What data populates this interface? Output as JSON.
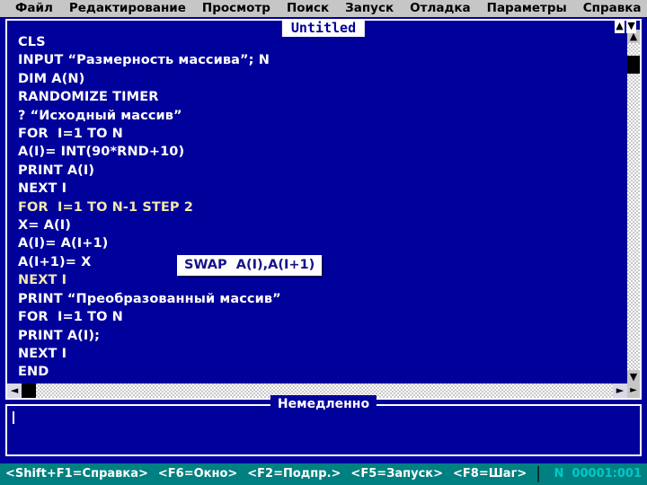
{
  "menubar": {
    "items": [
      {
        "label": "Файл",
        "name": "menu-file"
      },
      {
        "label": "Редактирование",
        "name": "menu-edit"
      },
      {
        "label": "Просмотр",
        "name": "menu-view"
      },
      {
        "label": "Поиск",
        "name": "menu-search"
      },
      {
        "label": "Запуск",
        "name": "menu-run"
      },
      {
        "label": "Отладка",
        "name": "menu-debug"
      },
      {
        "label": "Параметры",
        "name": "menu-options"
      },
      {
        "label": "Справка",
        "name": "menu-help"
      }
    ]
  },
  "editor": {
    "title": "Untitled",
    "scroll_marks": {
      "up": "▲",
      "down": "▼"
    },
    "code_lines": [
      {
        "text": "CLS",
        "highlight": false
      },
      {
        "text": "INPUT “Размерность массива”; N",
        "highlight": false
      },
      {
        "text": "DIM A(N)",
        "highlight": false
      },
      {
        "text": "RANDOMIZE TIMER",
        "highlight": false
      },
      {
        "text": "? “Исходный массив”",
        "highlight": false
      },
      {
        "text": "FOR  I=1 TO N",
        "highlight": false
      },
      {
        "text": "A(I)= INT(90*RND+10)",
        "highlight": false
      },
      {
        "text": "PRINT A(I)",
        "highlight": false
      },
      {
        "text": "NEXT I",
        "highlight": false
      },
      {
        "text": "FOR  I=1 TO N-1 STEP 2",
        "highlight": true
      },
      {
        "text": "X= A(I)",
        "highlight": false
      },
      {
        "text": "A(I)= A(I+1)",
        "highlight": false
      },
      {
        "text": "A(I+1)= X",
        "highlight": false
      },
      {
        "text": "NEXT I",
        "highlight": true
      },
      {
        "text": "PRINT “Преобразованный массив”",
        "highlight": false
      },
      {
        "text": "FOR  I=1 TO N",
        "highlight": false
      },
      {
        "text": "PRINT A(I);",
        "highlight": false
      },
      {
        "text": "NEXT I",
        "highlight": false
      },
      {
        "text": "END",
        "highlight": false
      }
    ],
    "annotation": "SWAP  A(I),A(I+1)",
    "vscroll": {
      "up": "▲",
      "down": "▼"
    },
    "hscroll": {
      "left": "◄",
      "right": "►"
    },
    "corner": "►"
  },
  "immediate": {
    "title": "Немедленно",
    "content": ""
  },
  "statusbar": {
    "hints": [
      "<Shift+F1=Справка>",
      "<F6=Окно>",
      "<F2=Подпр.>",
      "<F5=Запуск>",
      "<F8=Шаг>"
    ],
    "position": "N  00001:001"
  },
  "colors": {
    "window_bg": "#00009a",
    "menubar_bg": "#c6c6c6",
    "statusbar_bg": "#008080",
    "highlight_text": "#f2e8b0",
    "position_text": "#00c8c8"
  }
}
